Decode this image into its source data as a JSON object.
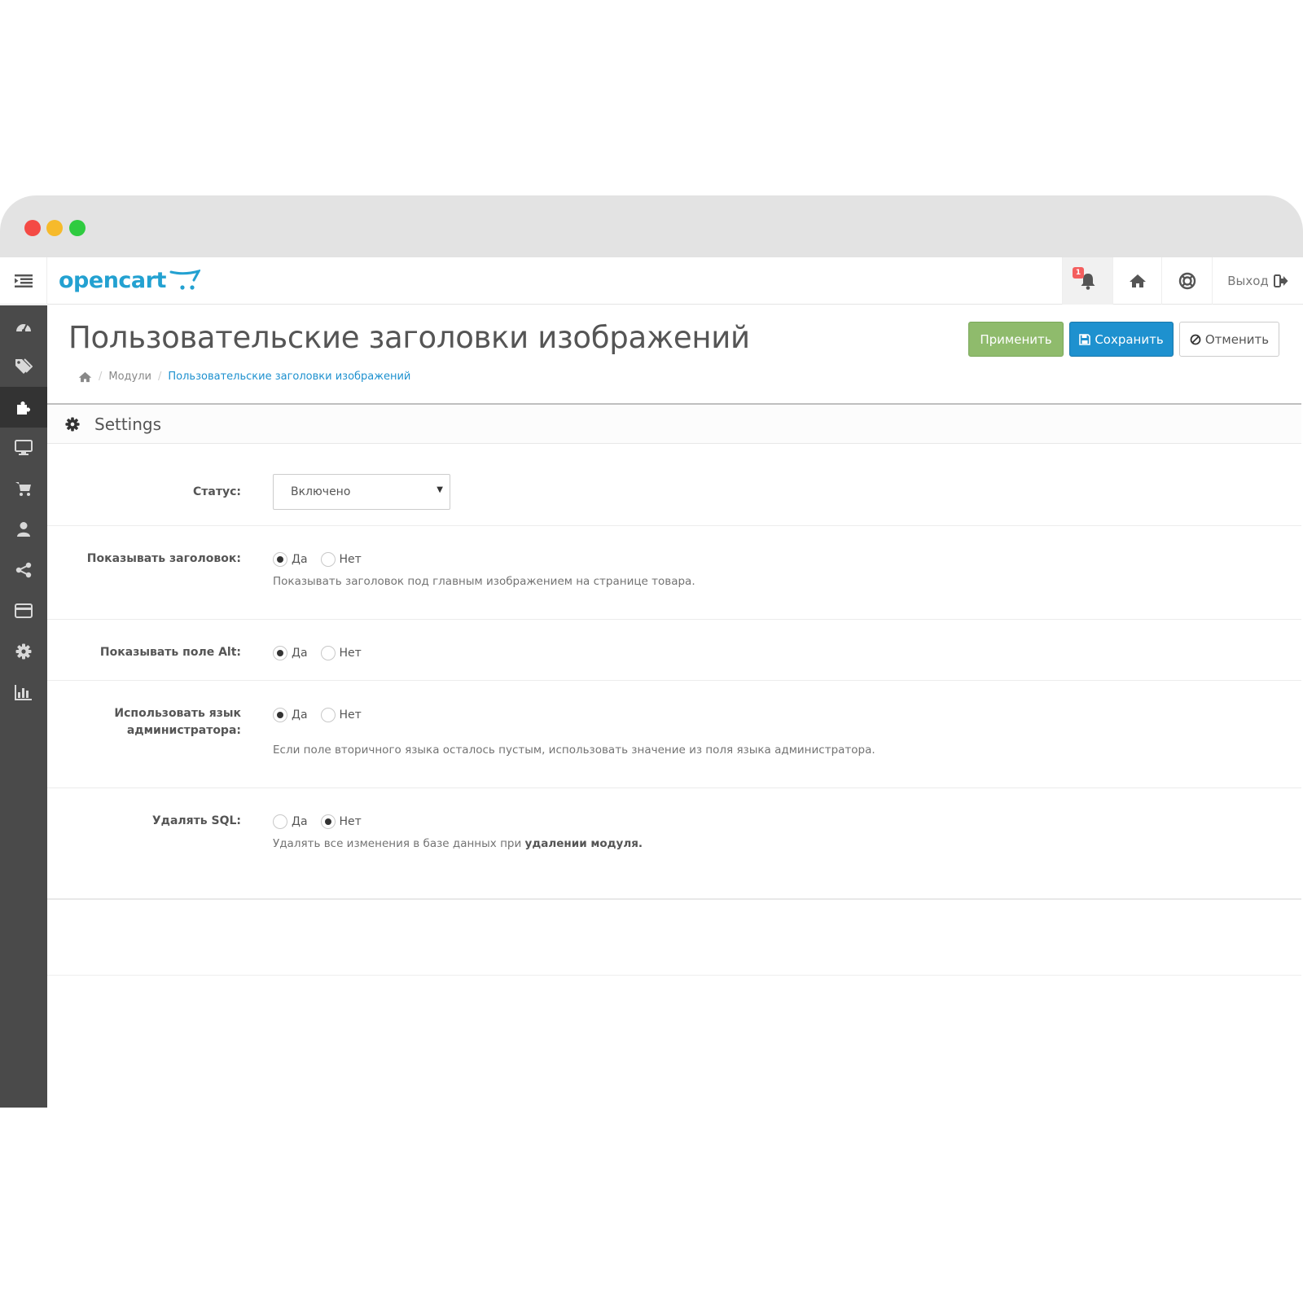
{
  "topbar": {
    "logo": "opencart",
    "notification_count": "1",
    "logout_label": "Выход"
  },
  "header": {
    "title": "Пользовательские заголовки изображений",
    "apply_label": "Применить",
    "save_label": "Сохранить",
    "cancel_label": "Отменить"
  },
  "breadcrumb": {
    "items": [
      "Модули",
      "Пользовательские заголовки изображений"
    ]
  },
  "panel": {
    "title": "Settings"
  },
  "form": {
    "status": {
      "label": "Статус:",
      "value": "Включено"
    },
    "show_title": {
      "label": "Показывать заголовок:",
      "yes": "Да",
      "no": "Нет",
      "selected": "yes",
      "help": "Показывать заголовок под главным изображением на странице товара."
    },
    "show_alt": {
      "label": "Показывать поле Alt:",
      "yes": "Да",
      "no": "Нет",
      "selected": "yes"
    },
    "admin_lang": {
      "label_line1": "Использовать язык",
      "label_line2": "администратора:",
      "yes": "Да",
      "no": "Нет",
      "selected": "yes",
      "help": "Если поле вторичного языка осталось пустым, использовать значение из поля языка администратора."
    },
    "delete_sql": {
      "label": "Удалять SQL:",
      "yes": "Да",
      "no": "Нет",
      "selected": "no",
      "help_prefix": "Удалять все изменения в базе данных при ",
      "help_bold": "удалении модуля."
    }
  },
  "colors": {
    "accent": "#1e91cf",
    "apply": "#8fbb6c",
    "sidebar": "#4a4a4a",
    "logo": "#23a1d1",
    "badge": "#f45e5e"
  }
}
